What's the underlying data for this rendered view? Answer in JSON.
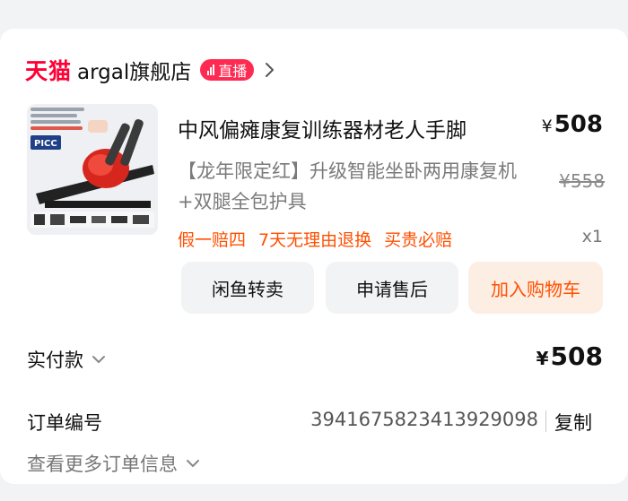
{
  "shop": {
    "platform_logo": "天猫",
    "name": "argal旗舰店",
    "live_label": "直播",
    "icon": "chevron-right-icon"
  },
  "product": {
    "title": "中风偏瘫康复训练器材老人手脚",
    "price_symbol": "¥",
    "price": "508",
    "spec": "【龙年限定红】升级智能坐卧两用康复机+双腿全包护具",
    "original_price": "¥558",
    "services": [
      "假一赔四",
      "7天无理由退换",
      "买贵必赔"
    ],
    "quantity": "x1",
    "thumbnail_texts": {
      "brand_badge": "PICC"
    },
    "accent_color": "#ff5000"
  },
  "actions": {
    "resell": "闲鱼转卖",
    "after_sales": "申请售后",
    "add_cart": "加入购物车"
  },
  "payment": {
    "label": "实付款",
    "symbol": "¥",
    "amount": "508"
  },
  "order": {
    "label": "订单编号",
    "number": "3941675823413929098",
    "copy": "复制",
    "more": "查看更多订单信息"
  }
}
